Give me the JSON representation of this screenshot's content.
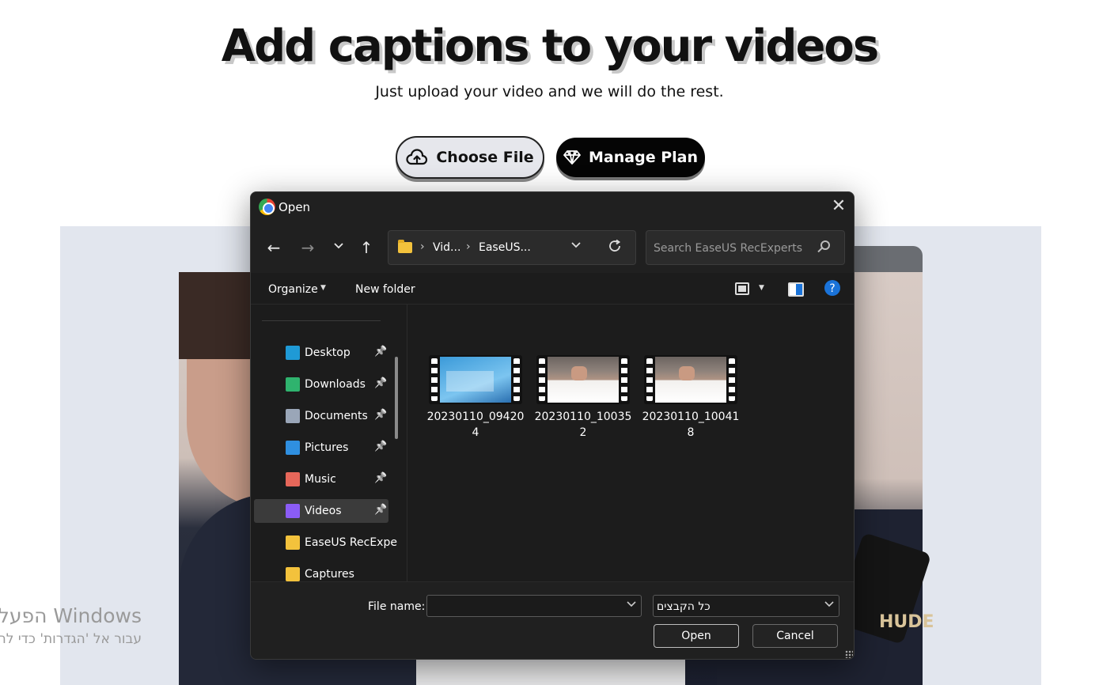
{
  "page": {
    "title": "Add captions to your videos",
    "subtitle": "Just upload your video and we will do the rest.",
    "choose_file_label": "Choose File",
    "manage_plan_label": "Manage Plan",
    "video_shirt_text": "HUDE",
    "windows_activation": {
      "line1": "הפעל את Windows",
      "line2": "עבור אל 'הגדרות' כדי להפעיל"
    }
  },
  "dialog": {
    "title": "Open",
    "nav": {
      "back": "←",
      "forward": "→",
      "recent": "⌄",
      "up": "↑"
    },
    "breadcrumb": [
      "Vid...",
      "EaseUS..."
    ],
    "search_placeholder": "Search EaseUS RecExperts",
    "toolbar": {
      "organize": "Organize",
      "new_folder": "New folder"
    },
    "sidebar": [
      {
        "label": "Desktop",
        "icon": "desktop-icon",
        "color": "#1f9ad6",
        "pinned": true
      },
      {
        "label": "Downloads",
        "icon": "downloads-icon",
        "color": "#2fb36e",
        "pinned": true
      },
      {
        "label": "Documents",
        "icon": "documents-icon",
        "color": "#9aa6b8",
        "pinned": true
      },
      {
        "label": "Pictures",
        "icon": "pictures-icon",
        "color": "#2f8fe0",
        "pinned": true
      },
      {
        "label": "Music",
        "icon": "music-icon",
        "color": "#e6675a",
        "pinned": true
      },
      {
        "label": "Videos",
        "icon": "videos-icon",
        "color": "#8b5cf6",
        "pinned": true,
        "selected": true
      },
      {
        "label": "EaseUS RecExpe",
        "icon": "folder-icon",
        "color": "#f3c23c",
        "pinned": false
      },
      {
        "label": "Captures",
        "icon": "folder-icon",
        "color": "#f3c23c",
        "pinned": false
      }
    ],
    "files": [
      {
        "name_line1": "20230110_09420",
        "name_line2": "4",
        "thumb": "blue"
      },
      {
        "name_line1": "20230110_10035",
        "name_line2": "2",
        "thumb": "desk"
      },
      {
        "name_line1": "20230110_10041",
        "name_line2": "8",
        "thumb": "desk"
      }
    ],
    "footer": {
      "file_name_label": "File name:",
      "file_name_value": "",
      "file_type_value": "כל הקבצים",
      "open_label": "Open",
      "cancel_label": "Cancel"
    }
  }
}
